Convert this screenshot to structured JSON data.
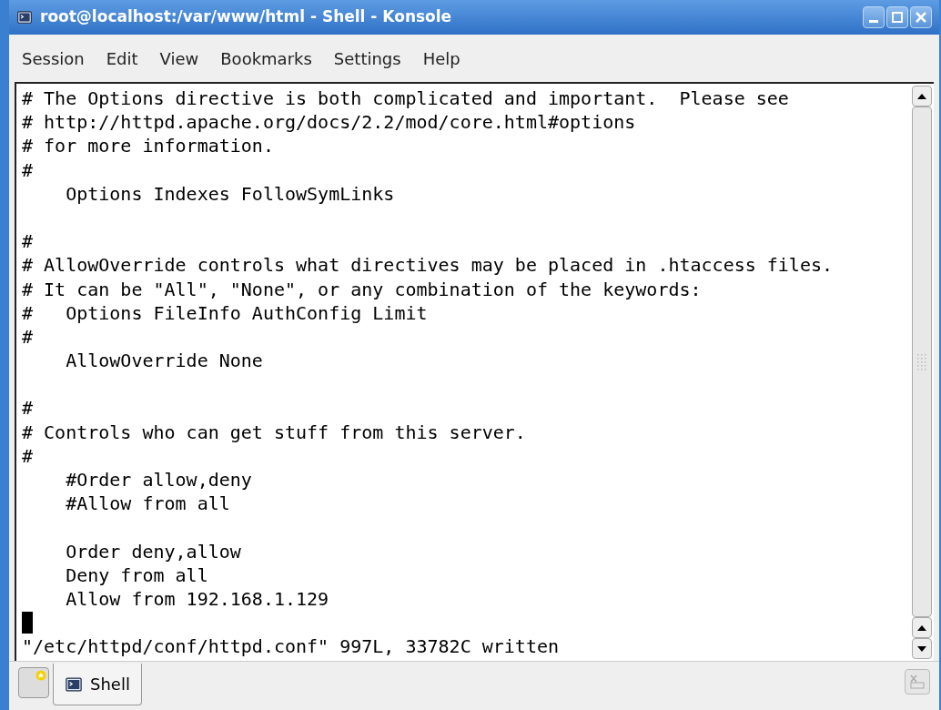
{
  "window": {
    "title": "root@localhost:/var/www/html - Shell - Konsole"
  },
  "menu": [
    "Session",
    "Edit",
    "View",
    "Bookmarks",
    "Settings",
    "Help"
  ],
  "terminal": {
    "lines": [
      {
        "kind": "text",
        "text": "# The Options directive is both complicated and important.  Please see"
      },
      {
        "kind": "text",
        "text": "# http://httpd.apache.org/docs/2.2/mod/core.html#options"
      },
      {
        "kind": "text",
        "text": "# for more information."
      },
      {
        "kind": "text",
        "text": "#"
      },
      {
        "kind": "text",
        "text": "    Options Indexes FollowSymLinks"
      },
      {
        "kind": "blank"
      },
      {
        "kind": "text",
        "text": "#"
      },
      {
        "kind": "text",
        "text": "# AllowOverride controls what directives may be placed in .htaccess files."
      },
      {
        "kind": "text",
        "text": "# It can be \"All\", \"None\", or any combination of the keywords:"
      },
      {
        "kind": "text",
        "text": "#   Options FileInfo AuthConfig Limit"
      },
      {
        "kind": "text",
        "text": "#"
      },
      {
        "kind": "text",
        "text": "    AllowOverride None"
      },
      {
        "kind": "blank"
      },
      {
        "kind": "text",
        "text": "#"
      },
      {
        "kind": "text",
        "text": "# Controls who can get stuff from this server."
      },
      {
        "kind": "text",
        "text": "#"
      },
      {
        "kind": "text",
        "text": "    #Order allow,deny"
      },
      {
        "kind": "text",
        "text": "    #Allow from all"
      },
      {
        "kind": "blank"
      },
      {
        "kind": "text",
        "text": "    Order deny,allow"
      },
      {
        "kind": "text",
        "text": "    Deny from all"
      },
      {
        "kind": "text",
        "text": "    Allow from 192.168.1.129"
      },
      {
        "kind": "cursor"
      },
      {
        "kind": "text",
        "text": "\"/etc/httpd/conf/httpd.conf\" 997L, 33782C written"
      }
    ]
  },
  "tabs": [
    {
      "label": "Shell",
      "selected": true
    }
  ]
}
